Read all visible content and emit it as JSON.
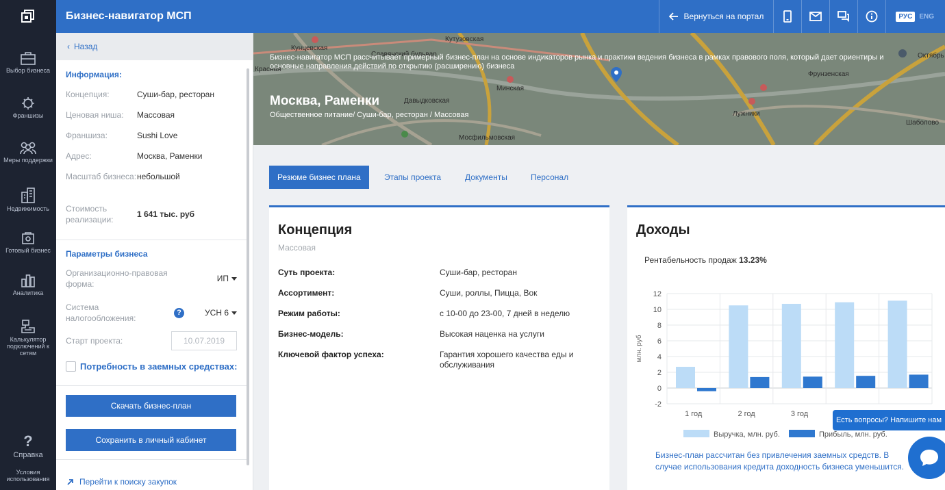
{
  "header": {
    "app_title": "Бизнес-навигатор МСП",
    "back_to_portal": "Вернуться на портал",
    "lang_ru": "РУС",
    "lang_en": "ENG"
  },
  "rail": {
    "items": [
      {
        "label": "Выбор бизнеса",
        "icon": "briefcase-icon"
      },
      {
        "label": "Франшизы",
        "icon": "franchise-icon"
      },
      {
        "label": "Меры поддержки",
        "icon": "support-people-icon"
      },
      {
        "label": "Недвижимость",
        "icon": "building-icon"
      },
      {
        "label": "Готовый бизнес",
        "icon": "ready-business-icon"
      },
      {
        "label": "Аналитика",
        "icon": "analytics-icon"
      },
      {
        "label": "Калькулятор подключений к сетям",
        "icon": "network-calculator-icon"
      },
      {
        "label": "Справка",
        "icon": "question-icon"
      },
      {
        "label": "Условия использования",
        "icon": "terms-icon"
      }
    ]
  },
  "side": {
    "back": "Назад",
    "info_title": "Информация:",
    "info": [
      {
        "label": "Концепция:",
        "value": "Суши-бар, ресторан"
      },
      {
        "label": "Ценовая ниша:",
        "value": "Массовая"
      },
      {
        "label": "Франшиза:",
        "value": "Sushi Love"
      },
      {
        "label": "Адрес:",
        "value": "Москва, Раменки"
      },
      {
        "label": "Масштаб бизнеса:",
        "value": "небольшой"
      },
      {
        "label": "Стоимость реализации:",
        "value": "1 641 тыс. руб"
      }
    ],
    "params_title": "Параметры бизнеса",
    "legal_form_label": "Организационно-правовая форма:",
    "legal_form_value": "ИП",
    "tax_label": "Система налогообложения:",
    "tax_value": "УСН 6",
    "start_label": "Старт проекта:",
    "start_value": "10.07.2019",
    "loan_label": "Потребность в заемных средствах:",
    "download_btn": "Скачать бизнес-план",
    "save_btn": "Сохранить в личный кабинет",
    "procurement_link": "Перейти к поиску закупок"
  },
  "hero": {
    "description": "Бизнес-навигатор МСП рассчитывает примерный бизнес-план на основе индикаторов рынка и практики ведения бизнеса в рамках правового поля, который дает ориентиры и основные направления действий по открытию (расширению) бизнеса",
    "city": "Москва, Раменки",
    "subtitle": "Общественное питание/ Суши-бар, ресторан / Массовая",
    "map_labels": [
      "Кунцевская",
      "Славянский бульвар",
      "Кутузовская",
      "Минская",
      "Давыдковская",
      "Мосфильмовская",
      "Фрунзенская",
      "Лужники",
      "Октябрь",
      "Шаболово",
      "Красная"
    ]
  },
  "tabs": [
    {
      "label": "Резюме бизнес плана",
      "active": true
    },
    {
      "label": "Этапы проекта",
      "active": false
    },
    {
      "label": "Документы",
      "active": false
    },
    {
      "label": "Персонал",
      "active": false
    }
  ],
  "concept": {
    "title": "Концепция",
    "subtitle": "Массовая",
    "rows": [
      {
        "key": "Суть проекта:",
        "value": "Суши-бар, ресторан"
      },
      {
        "key": "Ассортимент:",
        "value": "Суши, роллы, Пицца, Вок"
      },
      {
        "key": "Режим работы:",
        "value": "с 10-00 до 23-00, 7 дней в неделю"
      },
      {
        "key": "Бизнес-модель:",
        "value": "Высокая наценка на услуги"
      },
      {
        "key": "Ключевой фактор успеха:",
        "value": "Гарантия хорошего качества еды и обслуживания"
      }
    ]
  },
  "income": {
    "title": "Доходы",
    "profit_label": "Рентабельность продаж",
    "profit_value": "13.23%",
    "note": "Бизнес-план рассчитан без привлечения заемных средств. В случае использования кредита доходность бизнеса уменьшится."
  },
  "chart_data": {
    "type": "bar",
    "categories": [
      "1 год",
      "2 год",
      "3 год",
      "4 год",
      "5 год"
    ],
    "visible_category_labels": [
      "1 год",
      "2 год",
      "3 год"
    ],
    "series": [
      {
        "name": "Выручка, млн. руб.",
        "values": [
          2.7,
          10.5,
          10.7,
          10.9,
          11.1
        ],
        "color": "#bcdcf7"
      },
      {
        "name": "Прибыль, млн. руб.",
        "values": [
          -0.4,
          1.4,
          1.45,
          1.55,
          1.7
        ],
        "color": "#2f78cf"
      }
    ],
    "ylabel": "млн. руб",
    "ylim": [
      -2,
      12
    ],
    "yticks": [
      -2,
      0,
      2,
      4,
      6,
      8,
      10,
      12
    ],
    "grid": true,
    "legend": "bottom"
  },
  "chat": {
    "bubble": "Есть вопросы? Напишите нам"
  }
}
